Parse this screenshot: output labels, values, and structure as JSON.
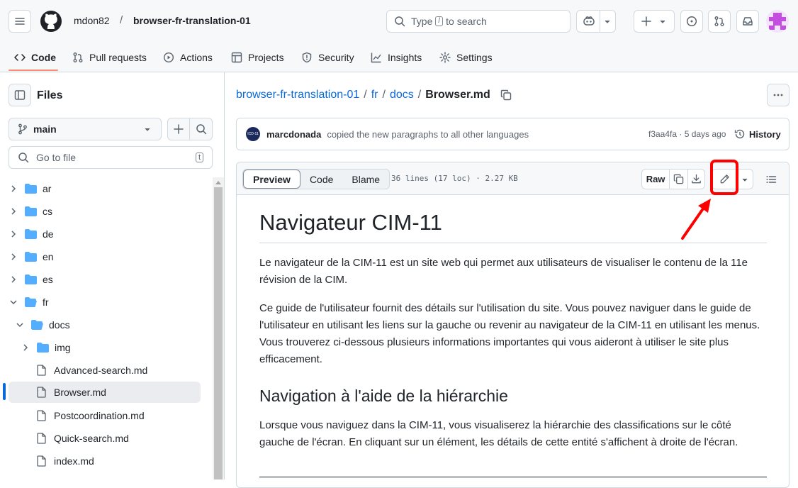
{
  "header": {
    "owner": "mdon82",
    "separator": "/",
    "repo": "browser-fr-translation-01",
    "search_prefix": "Type",
    "search_key": "/",
    "search_suffix": "to search"
  },
  "tabs": [
    {
      "label": "Code",
      "icon": "code-icon"
    },
    {
      "label": "Pull requests",
      "icon": "pull-request-icon"
    },
    {
      "label": "Actions",
      "icon": "play-icon"
    },
    {
      "label": "Projects",
      "icon": "table-icon"
    },
    {
      "label": "Security",
      "icon": "shield-icon"
    },
    {
      "label": "Insights",
      "icon": "graph-icon"
    },
    {
      "label": "Settings",
      "icon": "gear-icon"
    }
  ],
  "sidebar": {
    "title": "Files",
    "branch": "main",
    "goto_placeholder": "Go to file",
    "goto_key": "t",
    "tree": [
      {
        "label": "ar",
        "type": "folder"
      },
      {
        "label": "cs",
        "type": "folder"
      },
      {
        "label": "de",
        "type": "folder"
      },
      {
        "label": "en",
        "type": "folder"
      },
      {
        "label": "es",
        "type": "folder"
      },
      {
        "label": "fr",
        "type": "folder-open"
      },
      {
        "label": "docs",
        "type": "folder-open"
      },
      {
        "label": "img",
        "type": "folder"
      },
      {
        "label": "Advanced-search.md",
        "type": "file"
      },
      {
        "label": "Browser.md",
        "type": "file",
        "selected": true
      },
      {
        "label": "Postcoordination.md",
        "type": "file"
      },
      {
        "label": "Quick-search.md",
        "type": "file"
      },
      {
        "label": "index.md",
        "type": "file"
      }
    ]
  },
  "path": {
    "repo": "browser-fr-translation-01",
    "dir1": "fr",
    "dir2": "docs",
    "file": "Browser.md",
    "sep": "/"
  },
  "commit": {
    "author": "marcdonada",
    "message": "copied the new paragraphs to all other languages",
    "sha_time": "f3aa4fa · 5 days ago",
    "history": "History",
    "avatar_text": "ICD-11"
  },
  "file": {
    "tab_preview": "Preview",
    "tab_code": "Code",
    "tab_blame": "Blame",
    "meta": "36 lines (17 loc) · 2.27 KB",
    "raw": "Raw"
  },
  "content": {
    "h1": "Navigateur CIM-11",
    "p1": "Le navigateur de la CIM-11 est un site web qui permet aux utilisateurs de visualiser le contenu de la 11e révision de la CIM.",
    "p2": "Ce guide de l'utilisateur fournit des détails sur l'utilisation du site. Vous pouvez naviguer dans le guide de l'utilisateur en utilisant les liens sur la gauche ou revenir au navigateur de la CIM-11 en utilisant les menus. Vous trouverez ci-dessous plusieurs informations importantes qui vous aideront à utiliser le site plus efficacement.",
    "h2": "Navigation à l'aide de la hiérarchie",
    "p3": "Lorsque vous naviguez dans la CIM-11, vous visualiserez la hiérarchie des classifications sur le côté gauche de l'écran. En cliquant sur un élément, les détails de cette entité s'affichent à droite de l'écran."
  },
  "colors": {
    "accent": "#0969da",
    "highlight": "#ff0000",
    "folder": "#54aeff",
    "tab_underline": "#fd8c73"
  }
}
